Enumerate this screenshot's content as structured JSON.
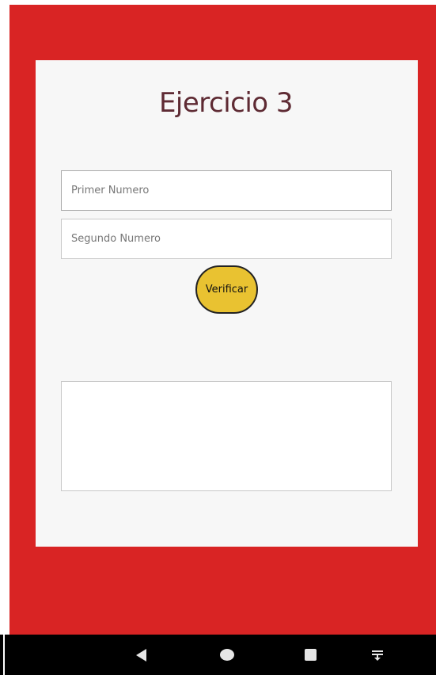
{
  "page": {
    "title": "Ejercicio 3"
  },
  "form": {
    "first_placeholder": "Primer Numero",
    "second_placeholder": "Segundo Numero",
    "first_value": "",
    "second_value": "",
    "verify_label": "Verificar",
    "result_text": ""
  },
  "navbar": {
    "icons": [
      "back-icon",
      "home-icon",
      "recents-icon",
      "notification-pulldown-icon"
    ]
  },
  "colors": {
    "background": "#d92424",
    "card": "#f7f7f7",
    "title": "#5e2a33",
    "button": "#e9c231",
    "navbar": "#000000"
  }
}
